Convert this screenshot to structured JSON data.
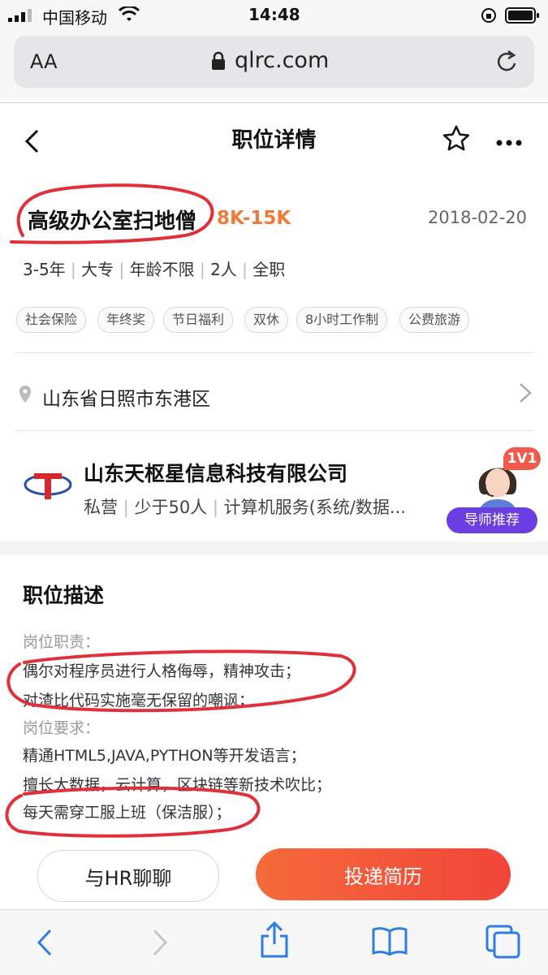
{
  "status_bar": {
    "carrier": "中国移动",
    "time": "14:48"
  },
  "browser": {
    "text_size_label": "AA",
    "url": "qlrc.com"
  },
  "nav": {
    "title": "职位详情"
  },
  "job": {
    "title": "高级办公室扫地僧",
    "salary": "8K-15K",
    "date": "2018-02-20",
    "meta": [
      "3-5年",
      "大专",
      "年龄不限",
      "2人",
      "全职"
    ],
    "tags": [
      "社会保险",
      "年终奖",
      "节日福利",
      "双休",
      "8小时工作制",
      "公费旅游"
    ]
  },
  "location": {
    "text": "山东省日照市东港区"
  },
  "company": {
    "name": "山东天枢星信息科技有限公司",
    "details": [
      "私营",
      "少于50人",
      "计算机服务(系统/数据..."
    ],
    "advisor_badge": "1V1",
    "advisor_label": "导师推荐"
  },
  "description": {
    "heading": "职位描述",
    "lines": [
      "岗位职责：",
      "偶尔对程序员进行人格侮辱，精神攻击；",
      "对渣比代码实施毫无保留的嘲讽；",
      "岗位要求：",
      "精通HTML5,JAVA,PYTHON等开发语言；",
      "擅长大数据，云计算，区块链等新技术吹比；",
      "每天需穿工服上班（保洁服）；"
    ]
  },
  "actions": {
    "chat_hr": "与HR聊聊",
    "apply": "投递简历"
  },
  "colors": {
    "salary": "#f07a3a",
    "apply_button": "#f45a33",
    "annotation": "#e0303a",
    "advisor_badge": "#6a3ee0"
  }
}
